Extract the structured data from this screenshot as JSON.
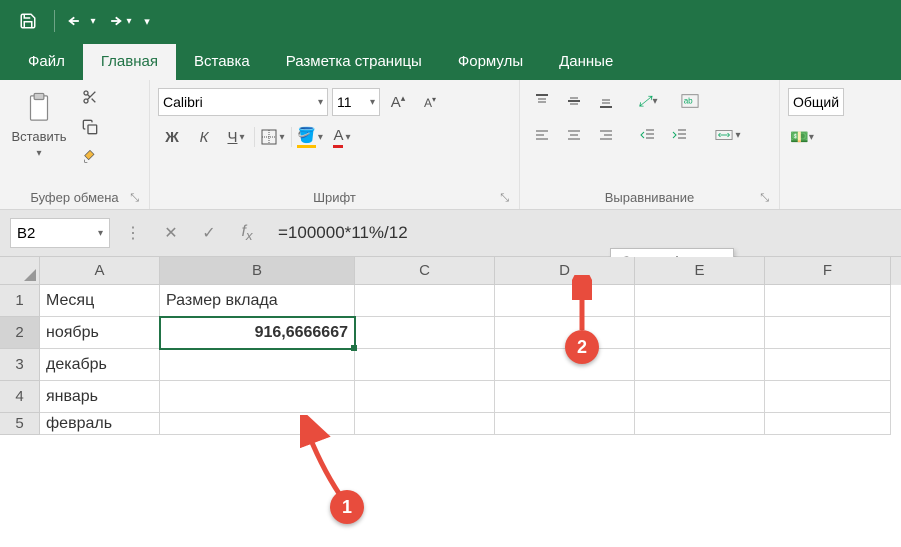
{
  "titlebar": {
    "save_icon": "save",
    "undo_icon": "undo",
    "redo_icon": "redo"
  },
  "tabs": {
    "file": "Файл",
    "home": "Главная",
    "insert": "Вставка",
    "layout": "Разметка страницы",
    "formulas": "Формулы",
    "data": "Данные"
  },
  "ribbon": {
    "clipboard": {
      "paste": "Вставить",
      "label": "Буфер обмена"
    },
    "font": {
      "name": "Calibri",
      "size": "11",
      "label": "Шрифт"
    },
    "alignment": {
      "label": "Выравнивание"
    },
    "number": {
      "format": "Общий"
    }
  },
  "name_box": "B2",
  "formula": "=100000*11%/12",
  "tooltip": "Строка формул",
  "columns": [
    "A",
    "B",
    "C",
    "D",
    "E",
    "F"
  ],
  "rows": {
    "r1": {
      "A": "Месяц",
      "B": "Размер вклада"
    },
    "r2": {
      "A": "ноябрь",
      "B": "916,6666667"
    },
    "r3": {
      "A": "декабрь"
    },
    "r4": {
      "A": "январь"
    },
    "r5": {
      "A": "февраль"
    }
  },
  "callouts": {
    "c1": "1",
    "c2": "2"
  }
}
